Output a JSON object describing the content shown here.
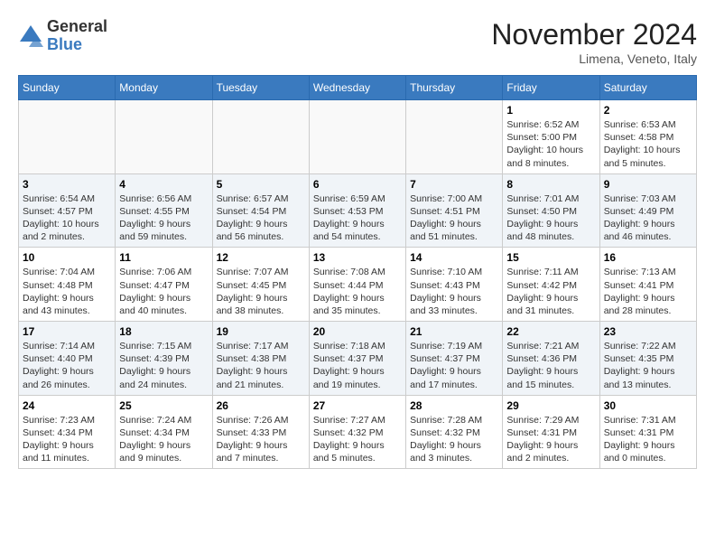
{
  "header": {
    "logo_line1": "General",
    "logo_line2": "Blue",
    "month_title": "November 2024",
    "location": "Limena, Veneto, Italy"
  },
  "days_of_week": [
    "Sunday",
    "Monday",
    "Tuesday",
    "Wednesday",
    "Thursday",
    "Friday",
    "Saturday"
  ],
  "weeks": [
    [
      {
        "day": "",
        "info": ""
      },
      {
        "day": "",
        "info": ""
      },
      {
        "day": "",
        "info": ""
      },
      {
        "day": "",
        "info": ""
      },
      {
        "day": "",
        "info": ""
      },
      {
        "day": "1",
        "info": "Sunrise: 6:52 AM\nSunset: 5:00 PM\nDaylight: 10 hours and 8 minutes."
      },
      {
        "day": "2",
        "info": "Sunrise: 6:53 AM\nSunset: 4:58 PM\nDaylight: 10 hours and 5 minutes."
      }
    ],
    [
      {
        "day": "3",
        "info": "Sunrise: 6:54 AM\nSunset: 4:57 PM\nDaylight: 10 hours and 2 minutes."
      },
      {
        "day": "4",
        "info": "Sunrise: 6:56 AM\nSunset: 4:55 PM\nDaylight: 9 hours and 59 minutes."
      },
      {
        "day": "5",
        "info": "Sunrise: 6:57 AM\nSunset: 4:54 PM\nDaylight: 9 hours and 56 minutes."
      },
      {
        "day": "6",
        "info": "Sunrise: 6:59 AM\nSunset: 4:53 PM\nDaylight: 9 hours and 54 minutes."
      },
      {
        "day": "7",
        "info": "Sunrise: 7:00 AM\nSunset: 4:51 PM\nDaylight: 9 hours and 51 minutes."
      },
      {
        "day": "8",
        "info": "Sunrise: 7:01 AM\nSunset: 4:50 PM\nDaylight: 9 hours and 48 minutes."
      },
      {
        "day": "9",
        "info": "Sunrise: 7:03 AM\nSunset: 4:49 PM\nDaylight: 9 hours and 46 minutes."
      }
    ],
    [
      {
        "day": "10",
        "info": "Sunrise: 7:04 AM\nSunset: 4:48 PM\nDaylight: 9 hours and 43 minutes."
      },
      {
        "day": "11",
        "info": "Sunrise: 7:06 AM\nSunset: 4:47 PM\nDaylight: 9 hours and 40 minutes."
      },
      {
        "day": "12",
        "info": "Sunrise: 7:07 AM\nSunset: 4:45 PM\nDaylight: 9 hours and 38 minutes."
      },
      {
        "day": "13",
        "info": "Sunrise: 7:08 AM\nSunset: 4:44 PM\nDaylight: 9 hours and 35 minutes."
      },
      {
        "day": "14",
        "info": "Sunrise: 7:10 AM\nSunset: 4:43 PM\nDaylight: 9 hours and 33 minutes."
      },
      {
        "day": "15",
        "info": "Sunrise: 7:11 AM\nSunset: 4:42 PM\nDaylight: 9 hours and 31 minutes."
      },
      {
        "day": "16",
        "info": "Sunrise: 7:13 AM\nSunset: 4:41 PM\nDaylight: 9 hours and 28 minutes."
      }
    ],
    [
      {
        "day": "17",
        "info": "Sunrise: 7:14 AM\nSunset: 4:40 PM\nDaylight: 9 hours and 26 minutes."
      },
      {
        "day": "18",
        "info": "Sunrise: 7:15 AM\nSunset: 4:39 PM\nDaylight: 9 hours and 24 minutes."
      },
      {
        "day": "19",
        "info": "Sunrise: 7:17 AM\nSunset: 4:38 PM\nDaylight: 9 hours and 21 minutes."
      },
      {
        "day": "20",
        "info": "Sunrise: 7:18 AM\nSunset: 4:37 PM\nDaylight: 9 hours and 19 minutes."
      },
      {
        "day": "21",
        "info": "Sunrise: 7:19 AM\nSunset: 4:37 PM\nDaylight: 9 hours and 17 minutes."
      },
      {
        "day": "22",
        "info": "Sunrise: 7:21 AM\nSunset: 4:36 PM\nDaylight: 9 hours and 15 minutes."
      },
      {
        "day": "23",
        "info": "Sunrise: 7:22 AM\nSunset: 4:35 PM\nDaylight: 9 hours and 13 minutes."
      }
    ],
    [
      {
        "day": "24",
        "info": "Sunrise: 7:23 AM\nSunset: 4:34 PM\nDaylight: 9 hours and 11 minutes."
      },
      {
        "day": "25",
        "info": "Sunrise: 7:24 AM\nSunset: 4:34 PM\nDaylight: 9 hours and 9 minutes."
      },
      {
        "day": "26",
        "info": "Sunrise: 7:26 AM\nSunset: 4:33 PM\nDaylight: 9 hours and 7 minutes."
      },
      {
        "day": "27",
        "info": "Sunrise: 7:27 AM\nSunset: 4:32 PM\nDaylight: 9 hours and 5 minutes."
      },
      {
        "day": "28",
        "info": "Sunrise: 7:28 AM\nSunset: 4:32 PM\nDaylight: 9 hours and 3 minutes."
      },
      {
        "day": "29",
        "info": "Sunrise: 7:29 AM\nSunset: 4:31 PM\nDaylight: 9 hours and 2 minutes."
      },
      {
        "day": "30",
        "info": "Sunrise: 7:31 AM\nSunset: 4:31 PM\nDaylight: 9 hours and 0 minutes."
      }
    ]
  ]
}
